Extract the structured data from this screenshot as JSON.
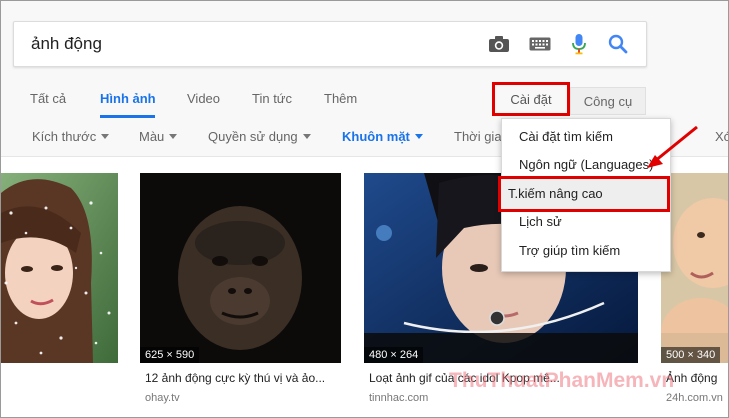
{
  "search": {
    "query": "ảnh động"
  },
  "tabs": [
    "Tất cả",
    "Hình ảnh",
    "Video",
    "Tin tức",
    "Thêm"
  ],
  "settings_label": "Cài đặt",
  "tools_label": "Công cụ",
  "filters": [
    "Kích thước",
    "Màu",
    "Quyền sử dụng",
    "Khuôn mặt",
    "Thời gia",
    "Xó"
  ],
  "menu": [
    "Cài đặt tìm kiếm",
    "Ngôn ngữ  (Languages)",
    "T.kiếm nâng cao",
    "Lịch sử",
    "Trợ giúp tìm kiếm"
  ],
  "results": [
    {
      "dims": "",
      "caption": "",
      "source": ""
    },
    {
      "dims": "625 × 590",
      "caption": "12 ảnh động cực kỳ thú vị và ảo...",
      "source": "ohay.tv"
    },
    {
      "dims": "480 × 264",
      "caption": "Loạt ảnh gif của các idol Kpop mê...",
      "source": "tinnhac.com"
    },
    {
      "dims": "500 × 340",
      "caption": "Ảnh động",
      "source": "24h.com.vn"
    }
  ],
  "watermark": "ThuThuatPhanMem.vn",
  "colors": {
    "accent": "#1a73e8",
    "highlight": "#e00000",
    "mic": "#4285f4"
  }
}
